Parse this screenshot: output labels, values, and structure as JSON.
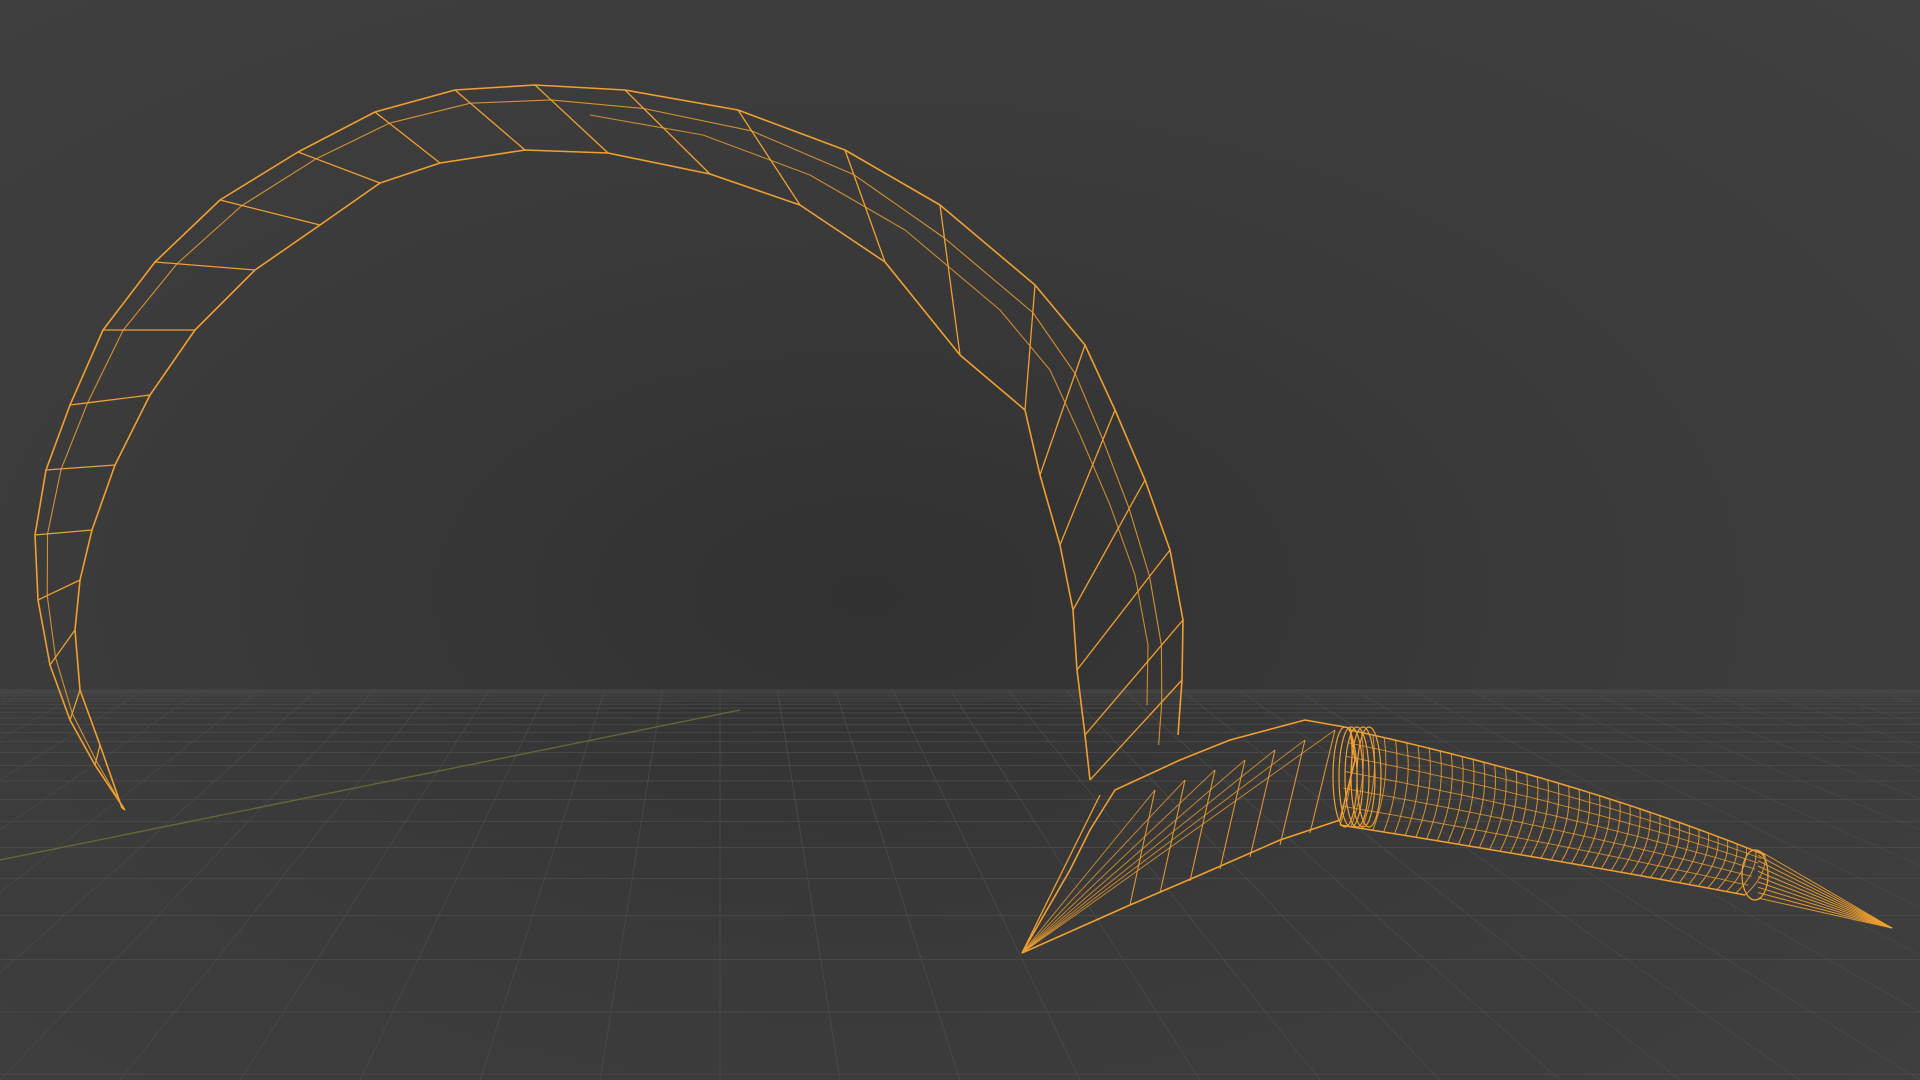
{
  "viewport": {
    "background_color": "#3a3a3a",
    "grid_color": "#4a4a4a",
    "wire_color": "#f0a030",
    "x_axis_color": "#6e6a35"
  },
  "scene": {
    "object": "scythe-mesh",
    "display_mode": "wireframe",
    "selected": true
  }
}
